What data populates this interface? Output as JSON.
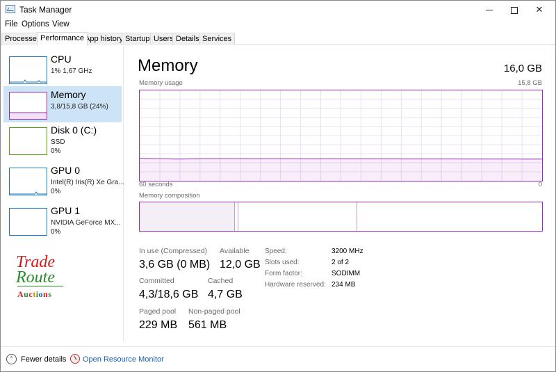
{
  "window": {
    "title": "Task Manager"
  },
  "menu": [
    {
      "label": "File"
    },
    {
      "label": "Options"
    },
    {
      "label": "View"
    }
  ],
  "tabs": [
    {
      "label": "Processes",
      "active": false
    },
    {
      "label": "Performance",
      "active": true
    },
    {
      "label": "App history",
      "active": false
    },
    {
      "label": "Startup",
      "active": false
    },
    {
      "label": "Users",
      "active": false
    },
    {
      "label": "Details",
      "active": false
    },
    {
      "label": "Services",
      "active": false
    }
  ],
  "resources": [
    {
      "title": "CPU",
      "line1": "1%  1,67 GHz",
      "line2": "",
      "color": "#1a79c4",
      "selected": false
    },
    {
      "title": "Memory",
      "line1": "3,8/15,8 GB (24%)",
      "line2": "",
      "color": "#9528b4",
      "selected": true
    },
    {
      "title": "Disk 0 (C:)",
      "line1": "SSD",
      "line2": "0%",
      "color": "#4da60c",
      "selected": false
    },
    {
      "title": "GPU 0",
      "line1": "Intel(R) Iris(R) Xe Gra...",
      "line2": "0%",
      "color": "#1a79c4",
      "selected": false
    },
    {
      "title": "GPU 1",
      "line1": "NVIDIA GeForce MX...",
      "line2": "0%",
      "color": "#1a79c4",
      "selected": false
    }
  ],
  "logo": {
    "line1": "Trade",
    "line2": "Route",
    "line3": "Auctions"
  },
  "main": {
    "title": "Memory",
    "total": "16,0 GB",
    "usage_label": "Memory usage",
    "usage_max": "15,8 GB",
    "time_left": "60 seconds",
    "time_right": "0",
    "composition_label": "Memory composition",
    "usage_level_fraction": 0.24,
    "composition_fractions": {
      "in_use": 0.237,
      "modified": 0.008,
      "standby": 0.295
    }
  },
  "stats": {
    "in_use_label": "In use (Compressed)",
    "in_use_value": "3,6 GB (0 MB)",
    "available_label": "Available",
    "available_value": "12,0 GB",
    "committed_label": "Committed",
    "committed_value": "4,3/18,6 GB",
    "cached_label": "Cached",
    "cached_value": "4,7 GB",
    "paged_label": "Paged pool",
    "paged_value": "229 MB",
    "nonpaged_label": "Non-paged pool",
    "nonpaged_value": "561 MB"
  },
  "specs": [
    {
      "label": "Speed:",
      "value": "3200 MHz"
    },
    {
      "label": "Slots used:",
      "value": "2 of 2"
    },
    {
      "label": "Form factor:",
      "value": "SODIMM"
    },
    {
      "label": "Hardware reserved:",
      "value": "234 MB"
    }
  ],
  "footer": {
    "fewer_details": "Fewer details",
    "open_resmon": "Open Resource Monitor"
  },
  "colors": {
    "memory_accent": "#9528b4",
    "selected_bg": "#cde4f7",
    "link": "#1a5fb4"
  }
}
